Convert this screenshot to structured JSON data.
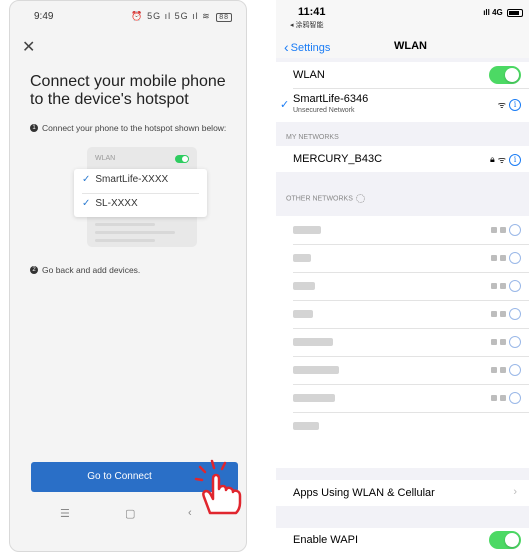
{
  "left": {
    "status_time": "9:49",
    "status_icons": "⏰ 5G ıl 5G ıl ≋",
    "battery": "88",
    "close_icon": "close-icon",
    "title": "Connect your mobile phone to the device's hotspot",
    "step1_num": "1",
    "step1_text": "Connect your phone to the hotspot shown below:",
    "illus_wlan_label": "WLAN",
    "networks": [
      "SmartLife-XXXX",
      "SL-XXXX"
    ],
    "step2_num": "2",
    "step2_text": "Go back and add devices.",
    "connect_button": "Go to Connect",
    "nav": {
      "menu": "☰",
      "home": "▢",
      "back": "‹"
    },
    "accent": "#2a6fc7"
  },
  "right": {
    "status_time": "11:41",
    "back_app": "◂ 涂鸦智能",
    "signal_text": "ıll 4G",
    "back_label": "Settings",
    "title": "WLAN",
    "wlan_label": "WLAN",
    "connected_name": "SmartLife-6346",
    "connected_sub": "Unsecured Network",
    "my_networks_head": "MY NETWORKS",
    "my_network": "MERCURY_B43C",
    "other_networks_head": "OTHER NETWORKS",
    "apps_using": "Apps Using WLAN & Cellular",
    "enable_wapi": "Enable WAPI",
    "accent": "#1a7cf5",
    "switch_color": "#4cd964"
  }
}
